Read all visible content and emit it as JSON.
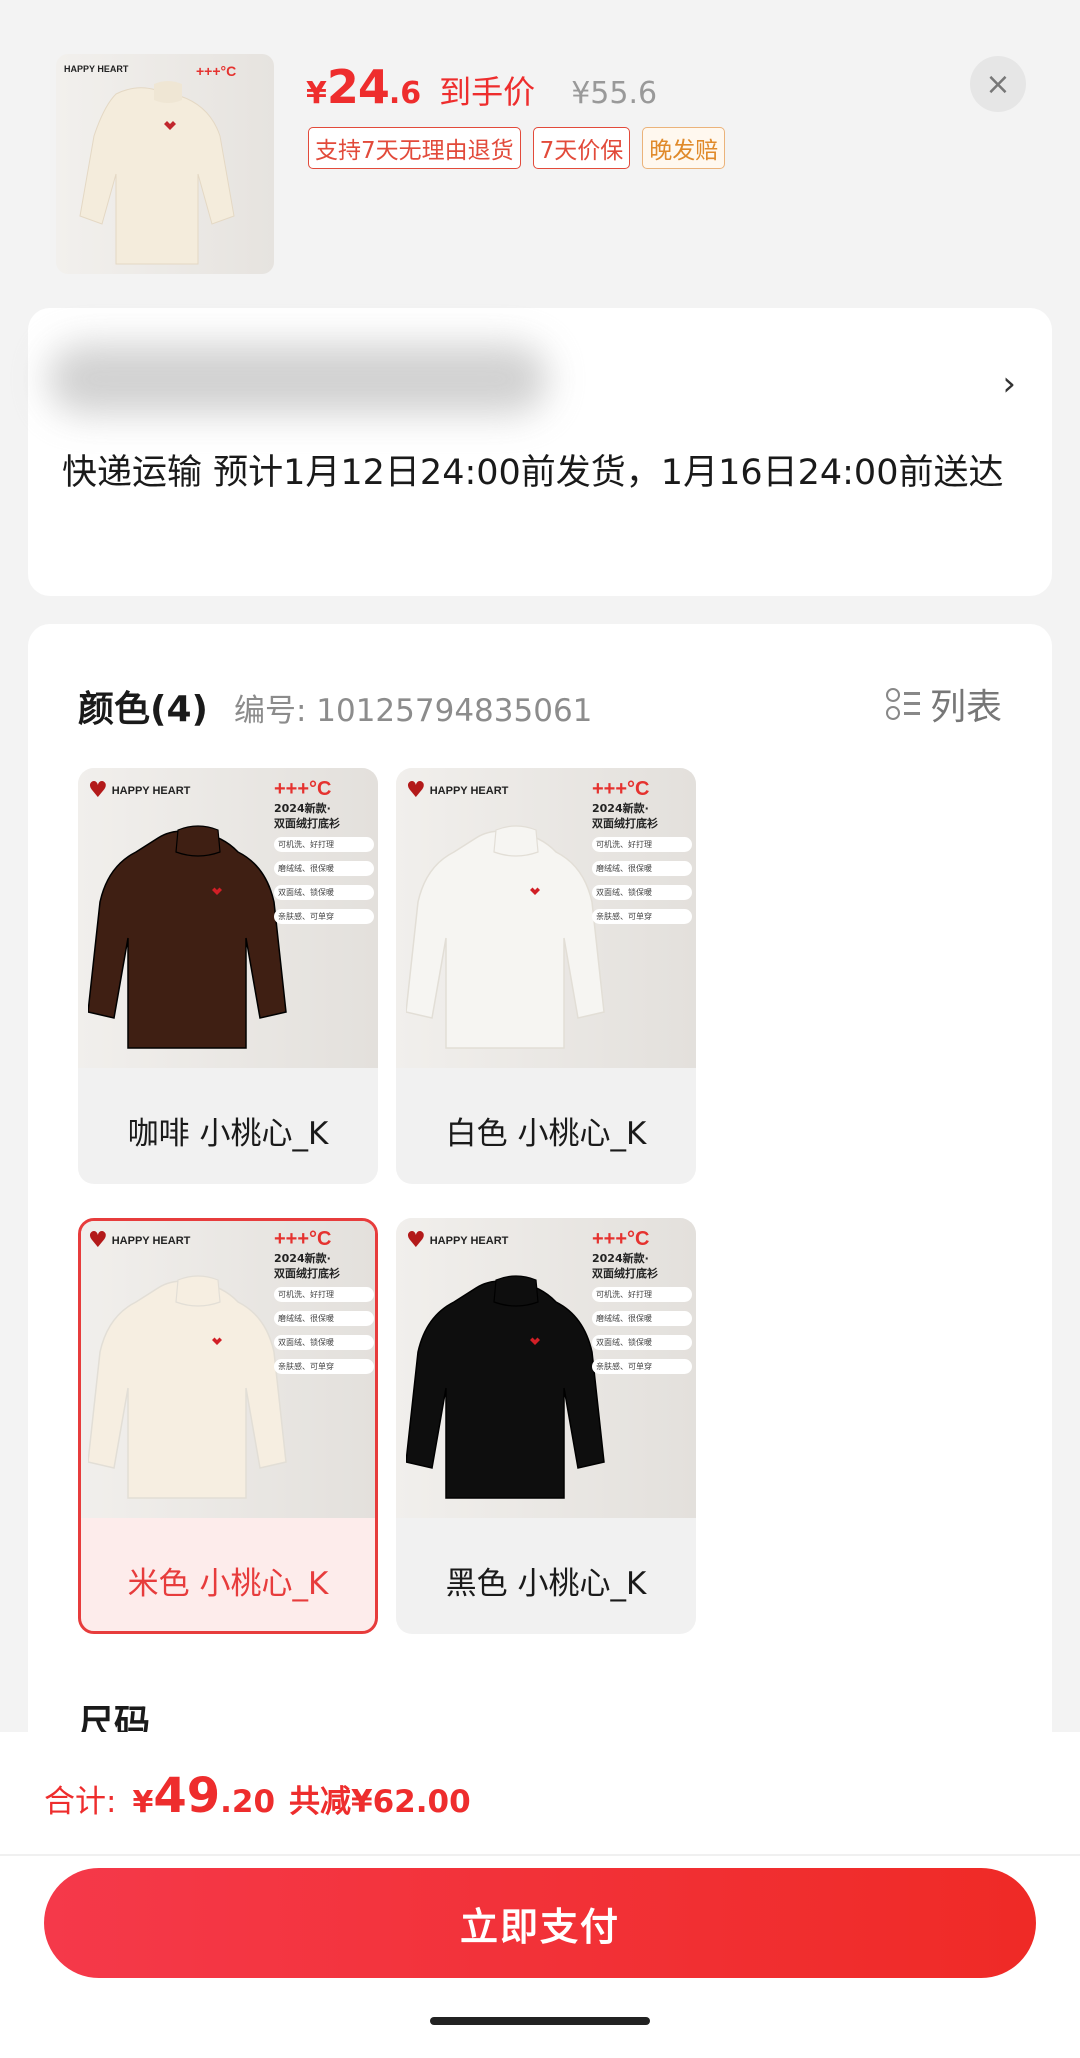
{
  "product": {
    "price_symbol": "¥",
    "price_int": "24",
    "price_dec": ".6",
    "price_label": "到手价",
    "original_price": "¥55.6",
    "tags": [
      "支持7天无理由退货",
      "7天价保",
      "晚发赔"
    ]
  },
  "close_icon": "×",
  "address": {
    "chevron": "›",
    "shipping": "快递运输 预计1月12日24:00前发货，1月16日24:00前送达"
  },
  "color": {
    "title": "颜色(4)",
    "sku_no": "编号: 10125794835061",
    "list_label": "列表"
  },
  "promo": {
    "brand": "HAPPY HEART",
    "degree": "+++°C",
    "line1": "2024新款·",
    "line2": "双面绒打底衫",
    "features": [
      "可机洗、好打理",
      "磨绒绒、很保暖",
      "双面绒、锁保暖",
      "亲肤感、可单穿"
    ]
  },
  "options": [
    {
      "label": "咖啡 小桃心_K",
      "color": "#3f1f13",
      "selected": false
    },
    {
      "label": "白色 小桃心_K",
      "color": "#f6f5f2",
      "selected": false
    },
    {
      "label": "米色 小桃心_K",
      "color": "#f6eee1",
      "selected": true
    },
    {
      "label": "黑色 小桃心_K",
      "color": "#0e0e0e",
      "selected": false
    }
  ],
  "size_title": "尺码",
  "footer": {
    "total_label": "合计:",
    "total_symbol": "¥",
    "total_int": "49",
    "total_dec": ".20",
    "total_save": "共减¥62.00",
    "pay_label": "立即支付"
  },
  "colors": {
    "accent": "#ee2d2d",
    "selected_border": "#e73c3c",
    "tag_orange": "#e08a2b"
  }
}
